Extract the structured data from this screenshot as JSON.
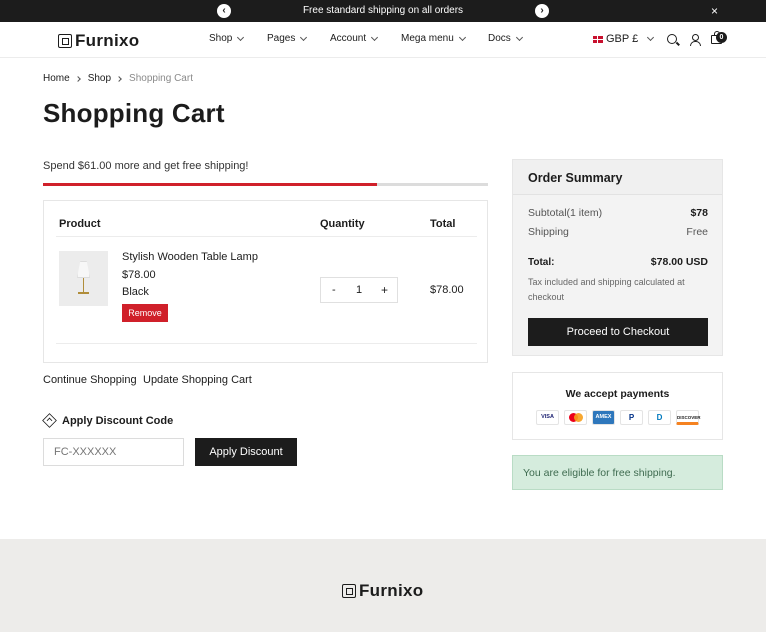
{
  "announcement": {
    "message": "Free standard shipping on all orders",
    "prev_icon": "chevron-left-icon",
    "next_icon": "chevron-right-icon",
    "close_label": "×"
  },
  "header": {
    "logo": "Furnixo",
    "nav": [
      {
        "label": "Shop"
      },
      {
        "label": "Pages"
      },
      {
        "label": "Account"
      },
      {
        "label": "Mega menu"
      },
      {
        "label": "Docs"
      }
    ],
    "locale": "GBP £",
    "cart_count": "0"
  },
  "breadcrumb": [
    "Home",
    "Shop",
    "Shopping Cart"
  ],
  "page_title": "Shopping Cart",
  "shipping": {
    "message": "Spend $61.00 more and get free shipping!",
    "progress_percent": 75,
    "progress_color": "#d0202a"
  },
  "cart": {
    "headers": {
      "product": "Product",
      "quantity": "Quantity",
      "total": "Total"
    },
    "items": [
      {
        "name": "Stylish Wooden Table Lamp",
        "price": "$78.00",
        "variant": "Black",
        "remove_label": "Remove",
        "quantity": "1",
        "minus": "-",
        "plus": "+",
        "line_total": "$78.00"
      }
    ],
    "continue_label": "Continue Shopping",
    "update_label": "Update Shopping Cart"
  },
  "discount": {
    "title": "Apply Discount Code",
    "placeholder": "FC-XXXXXX",
    "button": "Apply Discount"
  },
  "summary": {
    "title": "Order Summary",
    "subtotal_label": "Subtotal(1 item)",
    "subtotal_value": "$78",
    "shipping_label": "Shipping",
    "shipping_value": "Free",
    "total_label": "Total:",
    "total_value": "$78.00 USD",
    "tax_note": "Tax included and shipping calculated at checkout",
    "checkout_button": "Proceed to Checkout"
  },
  "payments": {
    "title": "We accept payments",
    "cards": [
      "VISA",
      "MC",
      "AMEX",
      "P",
      "D",
      "DISCOVER"
    ]
  },
  "eligible_message": "You are eligible for free shipping.",
  "footer": {
    "logo": "Furnixo"
  },
  "colors": {
    "accent_red": "#d0202a",
    "dark": "#1c1c1c",
    "success_bg": "#d5ecdd"
  }
}
